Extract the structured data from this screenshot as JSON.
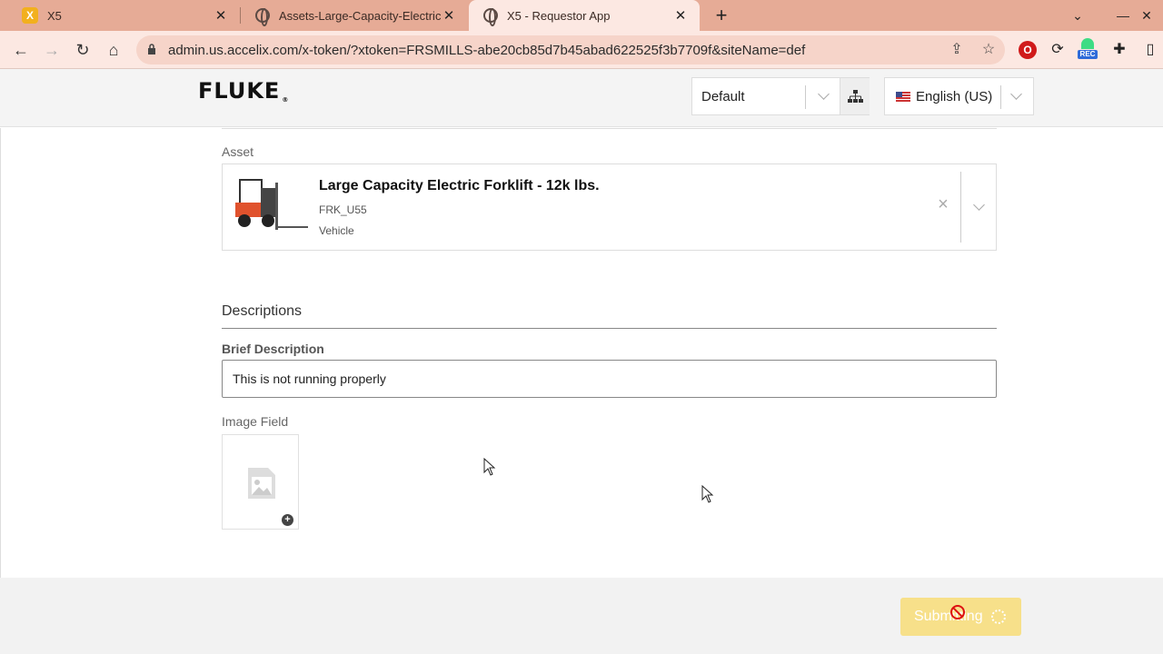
{
  "browser": {
    "tabs": [
      {
        "title": "X5",
        "active": false,
        "favicon": "x5-logo-icon"
      },
      {
        "title": "Assets-Large-Capacity-Electric-Fo",
        "active": false,
        "favicon": "globe-icon"
      },
      {
        "title": "X5 - Requestor App",
        "active": true,
        "favicon": "globe-icon"
      }
    ],
    "new_tab": "+",
    "url": "admin.us.accelix.com/x-token/?xtoken=FRSMILLS-abe20cb85d7b45abad622525f3b7709f&siteName=def",
    "extensions": {
      "rec_label": "REC"
    }
  },
  "header": {
    "logo_text": "FLUKE",
    "logo_mark": "®",
    "site_select_value": "Default",
    "language_select_value": "English (US)"
  },
  "form": {
    "asset_label": "Asset",
    "asset": {
      "name": "Large Capacity Electric Forklift - 12k lbs.",
      "code": "FRK_U55",
      "type": "Vehicle"
    },
    "descriptions_title": "Descriptions",
    "brief_description_label": "Brief Description",
    "brief_description_value": "This is not running properly",
    "image_field_label": "Image Field"
  },
  "footer": {
    "submit_label": "Submitting"
  },
  "colors": {
    "tab_strip": "#e6ab96",
    "toolbar": "#fce8e2",
    "submit_button": "#f7e08a"
  }
}
